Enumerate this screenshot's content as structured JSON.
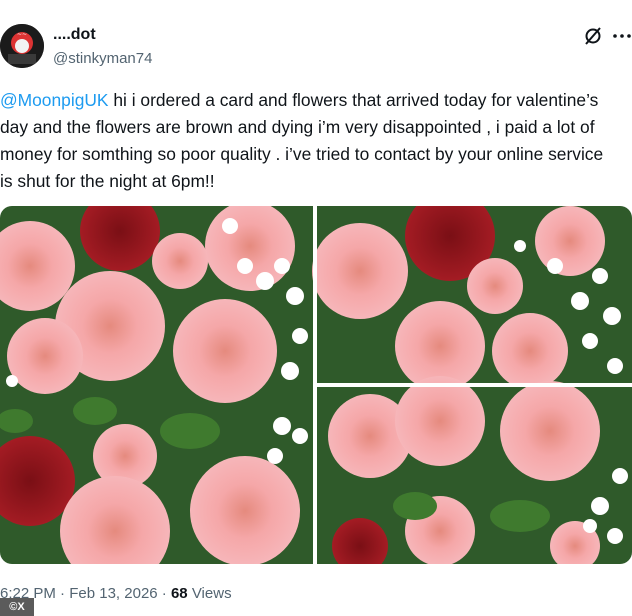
{
  "author": {
    "display_name": "....dot",
    "handle": "@stinkyman74",
    "avatar_icon": "avatar-icon"
  },
  "header_icons": {
    "grok": "grok-icon",
    "more": "more-icon"
  },
  "tweet": {
    "mention": "@MoonpigUK",
    "body": " hi i ordered a card and flowers that arrived today for valentine’s day and the flowers are brown and dying i’m very disappointed , i paid a lot of money for somthing so poor quality . i’ve tried to contact by your online service is shut for the night at 6pm!!"
  },
  "media": {
    "image_count": 3
  },
  "meta": {
    "time": "6:22 PM",
    "separator1": " · ",
    "date": "Feb 13, 2026",
    "separator2": " · ",
    "views_count": "68",
    "views_label": " Views"
  },
  "watermark": "©X",
  "colors": {
    "link": "#1d9bf0",
    "secondary_text": "#536471",
    "primary_text": "#0f1419"
  }
}
